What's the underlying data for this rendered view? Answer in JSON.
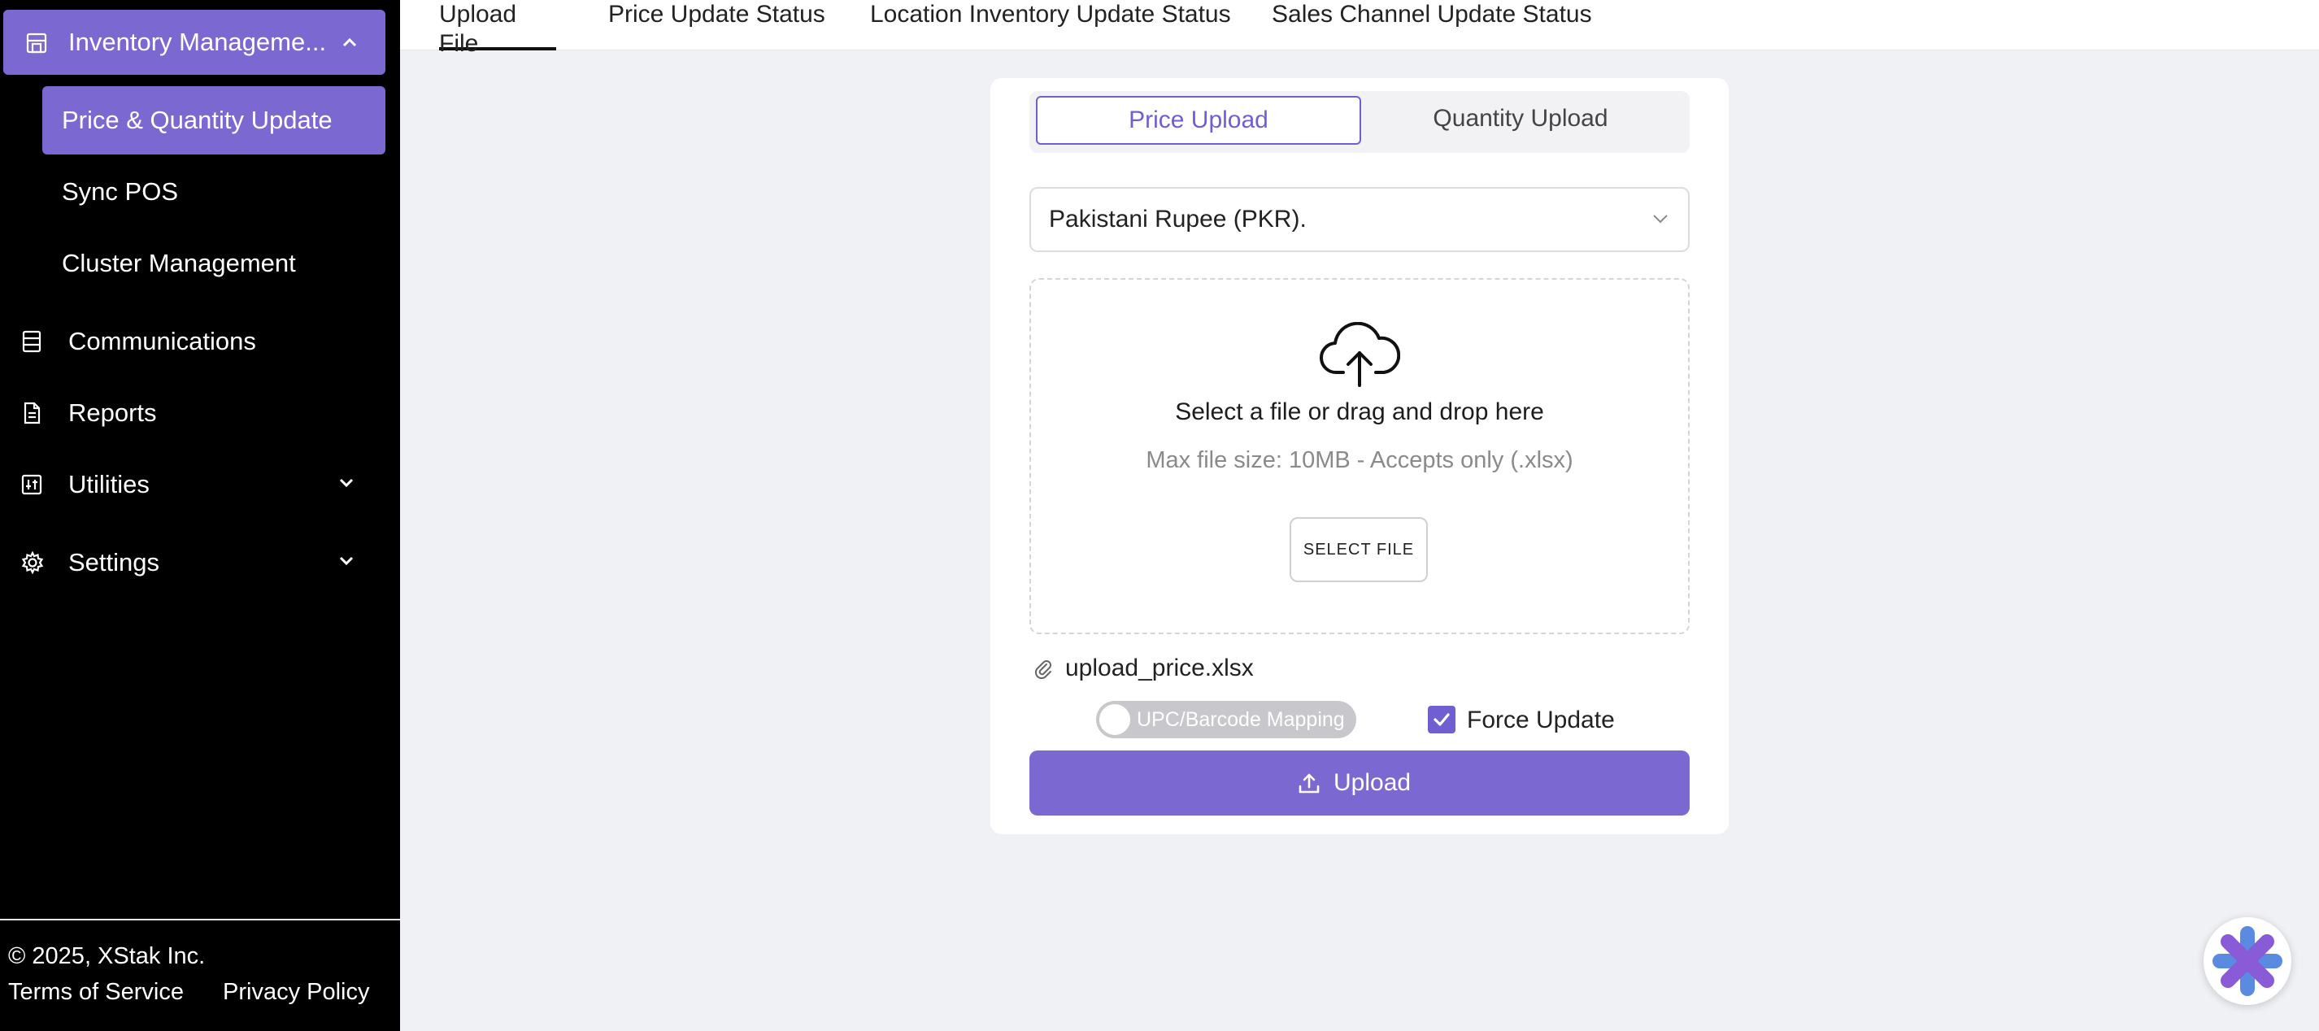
{
  "sidebar": {
    "group": {
      "label": "Inventory Manageme...",
      "icon": "store-icon",
      "expanded": true
    },
    "sub_items": [
      {
        "label": "Price & Quantity Update",
        "active": true
      },
      {
        "label": "Sync POS",
        "active": false
      },
      {
        "label": "Cluster Management",
        "active": false
      }
    ],
    "items": [
      {
        "label": "Communications",
        "icon": "list-icon",
        "has_chevron": false
      },
      {
        "label": "Reports",
        "icon": "document-icon",
        "has_chevron": false
      },
      {
        "label": "Utilities",
        "icon": "sliders-icon",
        "has_chevron": true
      },
      {
        "label": "Settings",
        "icon": "gear-icon",
        "has_chevron": true
      }
    ],
    "footer": {
      "copyright": "© 2025, XStak Inc.",
      "terms": "Terms of Service",
      "privacy": "Privacy Policy"
    }
  },
  "tabs": [
    {
      "label": "Upload File",
      "active": true
    },
    {
      "label": "Price Update Status",
      "active": false
    },
    {
      "label": "Location Inventory Update Status",
      "active": false
    },
    {
      "label": "Sales Channel Update Status",
      "active": false
    }
  ],
  "card": {
    "segments": [
      {
        "label": "Price Upload",
        "active": true
      },
      {
        "label": "Quantity Upload",
        "active": false
      }
    ],
    "currency": {
      "value": "Pakistani Rupee (PKR)."
    },
    "dropzone": {
      "title": "Select a file or drag and drop here",
      "subtitle": "Max file size: 10MB - Accepts only (.xlsx)",
      "button": "SELECT FILE"
    },
    "file_name": "upload_price.xlsx",
    "toggle": {
      "label": "UPC/Barcode Mapping",
      "on": false
    },
    "force_update": {
      "label": "Force Update",
      "checked": true
    },
    "upload_button": "Upload"
  },
  "colors": {
    "accent": "#7b68d0",
    "sidebar_bg": "#000000",
    "page_bg": "#f0f1f5"
  }
}
